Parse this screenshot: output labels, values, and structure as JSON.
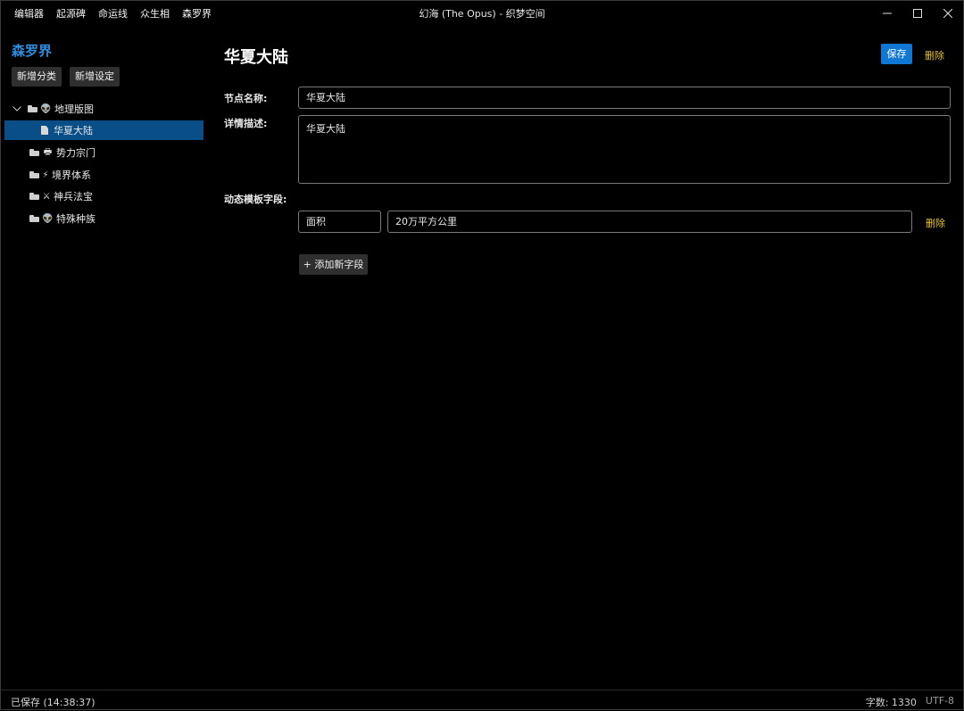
{
  "menu": [
    "编辑器",
    "起源碑",
    "命运线",
    "众生相",
    "森罗界"
  ],
  "window_title": "幻海 (The Opus) - 织梦空间",
  "sidebar": {
    "title": "森罗界",
    "add_category_label": "新增分类",
    "add_setting_label": "新增设定",
    "tree": [
      {
        "icon": "alien-icon",
        "glyph": "👽",
        "label": "地理版图",
        "expanded": true
      },
      {
        "icon": "document-icon",
        "label": "华夏大陆",
        "selected": true
      },
      {
        "icon": "printer-icon",
        "glyph": "🖶",
        "label": "势力宗门"
      },
      {
        "icon": "lightning-icon",
        "glyph": "⚡",
        "label": "境界体系"
      },
      {
        "icon": "crossed-swords-icon",
        "glyph": "⚔",
        "label": "神兵法宝"
      },
      {
        "icon": "alien-icon",
        "glyph": "👽",
        "label": "特殊种族"
      }
    ]
  },
  "main": {
    "title": "华夏大陆",
    "save_label": "保存",
    "delete_label": "删除",
    "node_name_label": "节点名称:",
    "node_name_value": "华夏大陆",
    "description_label": "详情描述:",
    "description_value": "华夏大陆",
    "dynamic_fields_label": "动态模板字段:",
    "dynamic_fields": [
      {
        "key": "面积",
        "value": "20万平方公里",
        "delete_label": "删除"
      }
    ],
    "add_field_label": "+ 添加新字段"
  },
  "status": {
    "saved_text": "已保存 (14:38:37)",
    "word_count": "字数: 1330",
    "encoding": "UTF-8"
  },
  "colors": {
    "accent": "#1177d4",
    "sidebar_title": "#2f8fe0",
    "selected_row": "#094e86",
    "delete_link": "#e4c02a"
  }
}
